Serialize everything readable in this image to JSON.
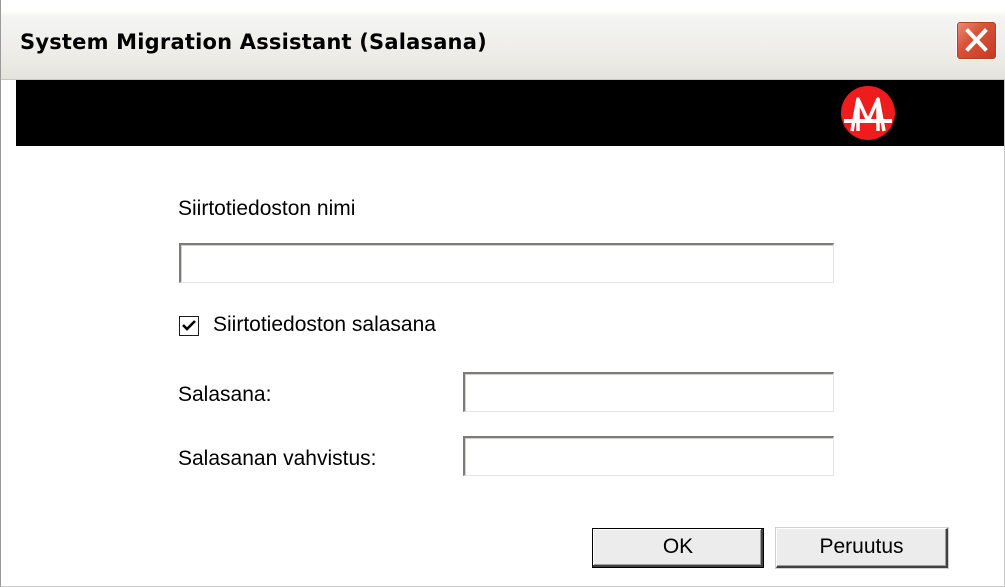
{
  "window": {
    "title": "System Migration Assistant (Salasana)"
  },
  "banner": {
    "logo_icon": "sma-bridge-logo-icon",
    "logo_color": "#ee1c1c"
  },
  "form": {
    "filename_label": "Siirtotiedoston nimi",
    "filename_value": "",
    "password_checkbox_label": "Siirtotiedoston salasana",
    "password_checkbox_checked": true,
    "password_label": "Salasana:",
    "password_value": "",
    "confirm_label": "Salasanan vahvistus:",
    "confirm_value": ""
  },
  "buttons": {
    "ok_label": "OK",
    "cancel_label": "Peruutus"
  }
}
